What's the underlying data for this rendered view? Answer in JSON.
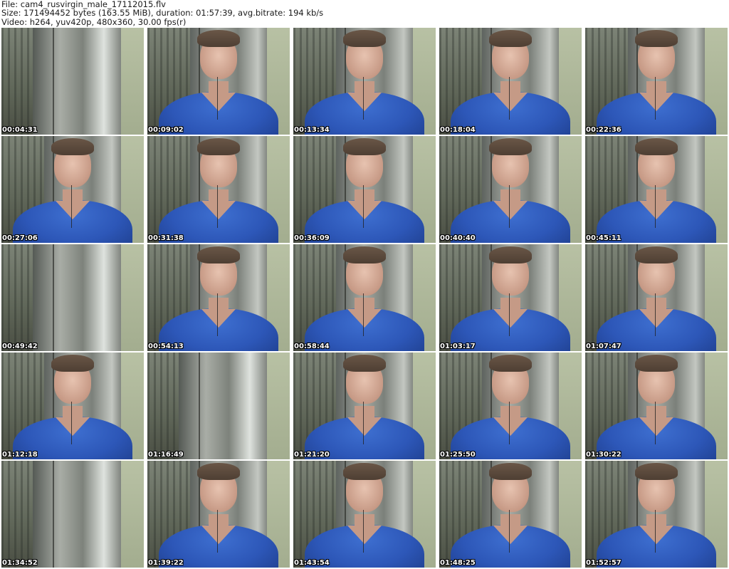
{
  "header": {
    "line1": "File: cam4_rusvirgin_male_17112015.flv",
    "line2": "Size: 171494452 bytes (163.55 MiB), duration: 01:57:39, avg.bitrate: 194 kb/s",
    "line3": "Video: h264, yuv420p, 480x360, 30.00 fps(r)"
  },
  "thumbnails": [
    {
      "timestamp": "00:04:31",
      "subject": false
    },
    {
      "timestamp": "00:09:02",
      "subject": true
    },
    {
      "timestamp": "00:13:34",
      "subject": true
    },
    {
      "timestamp": "00:18:04",
      "subject": true
    },
    {
      "timestamp": "00:22:36",
      "subject": true
    },
    {
      "timestamp": "00:27:06",
      "subject": true
    },
    {
      "timestamp": "00:31:38",
      "subject": true
    },
    {
      "timestamp": "00:36:09",
      "subject": true
    },
    {
      "timestamp": "00:40:40",
      "subject": true
    },
    {
      "timestamp": "00:45:11",
      "subject": true
    },
    {
      "timestamp": "00:49:42",
      "subject": false
    },
    {
      "timestamp": "00:54:13",
      "subject": true
    },
    {
      "timestamp": "00:58:44",
      "subject": true
    },
    {
      "timestamp": "01:03:17",
      "subject": true
    },
    {
      "timestamp": "01:07:47",
      "subject": true
    },
    {
      "timestamp": "01:12:18",
      "subject": true
    },
    {
      "timestamp": "01:16:49",
      "subject": false
    },
    {
      "timestamp": "01:21:20",
      "subject": true
    },
    {
      "timestamp": "01:25:50",
      "subject": true
    },
    {
      "timestamp": "01:30:22",
      "subject": true
    },
    {
      "timestamp": "01:34:52",
      "subject": false
    },
    {
      "timestamp": "01:39:22",
      "subject": true
    },
    {
      "timestamp": "01:43:54",
      "subject": true
    },
    {
      "timestamp": "01:48:25",
      "subject": true
    },
    {
      "timestamp": "01:52:57",
      "subject": true
    }
  ]
}
